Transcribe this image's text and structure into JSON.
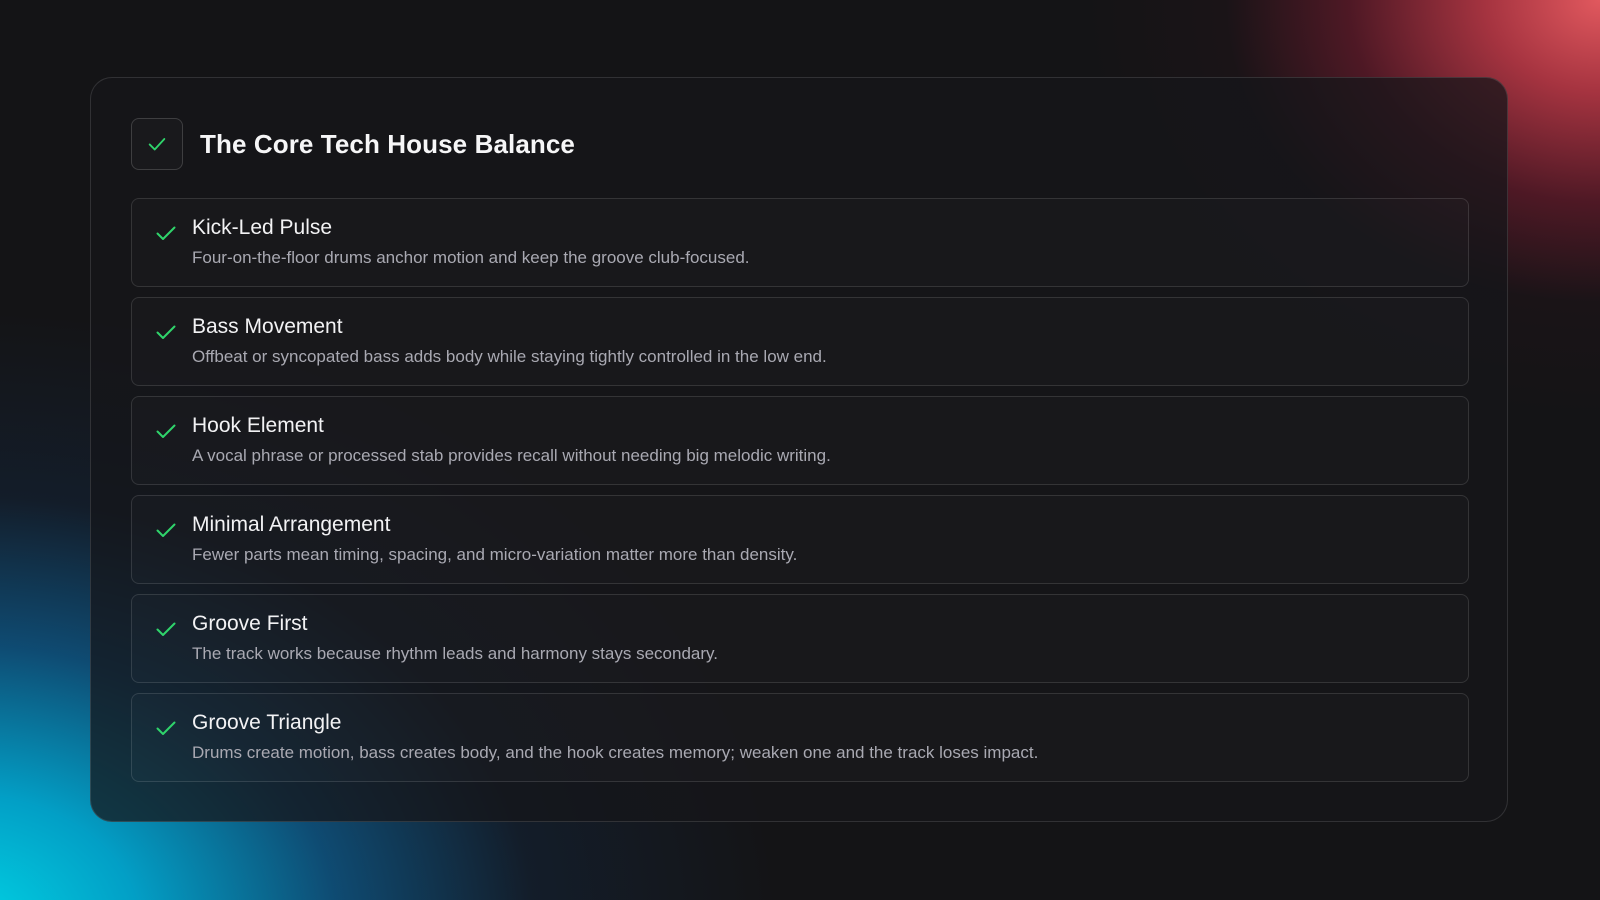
{
  "colors": {
    "accent_check": "#2fd46b",
    "text_primary": "#f2f2f4",
    "text_secondary": "#a9a9b2",
    "gradient_top_right": "#e25a62",
    "gradient_bottom_left": "#00c8e0"
  },
  "header": {
    "icon": "check-icon",
    "title": "The Core Tech House Balance"
  },
  "items": [
    {
      "icon": "check-icon",
      "title": "Kick-Led Pulse",
      "description": "Four-on-the-floor drums anchor motion and keep the groove club-focused."
    },
    {
      "icon": "check-icon",
      "title": "Bass Movement",
      "description": "Offbeat or syncopated bass adds body while staying tightly controlled in the low end."
    },
    {
      "icon": "check-icon",
      "title": "Hook Element",
      "description": "A vocal phrase or processed stab provides recall without needing big melodic writing."
    },
    {
      "icon": "check-icon",
      "title": "Minimal Arrangement",
      "description": "Fewer parts mean timing, spacing, and micro-variation matter more than density."
    },
    {
      "icon": "check-icon",
      "title": "Groove First",
      "description": "The track works because rhythm leads and harmony stays secondary."
    },
    {
      "icon": "check-icon",
      "title": "Groove Triangle",
      "description": "Drums create motion, bass creates body, and the hook creates memory; weaken one and the track loses impact."
    }
  ]
}
